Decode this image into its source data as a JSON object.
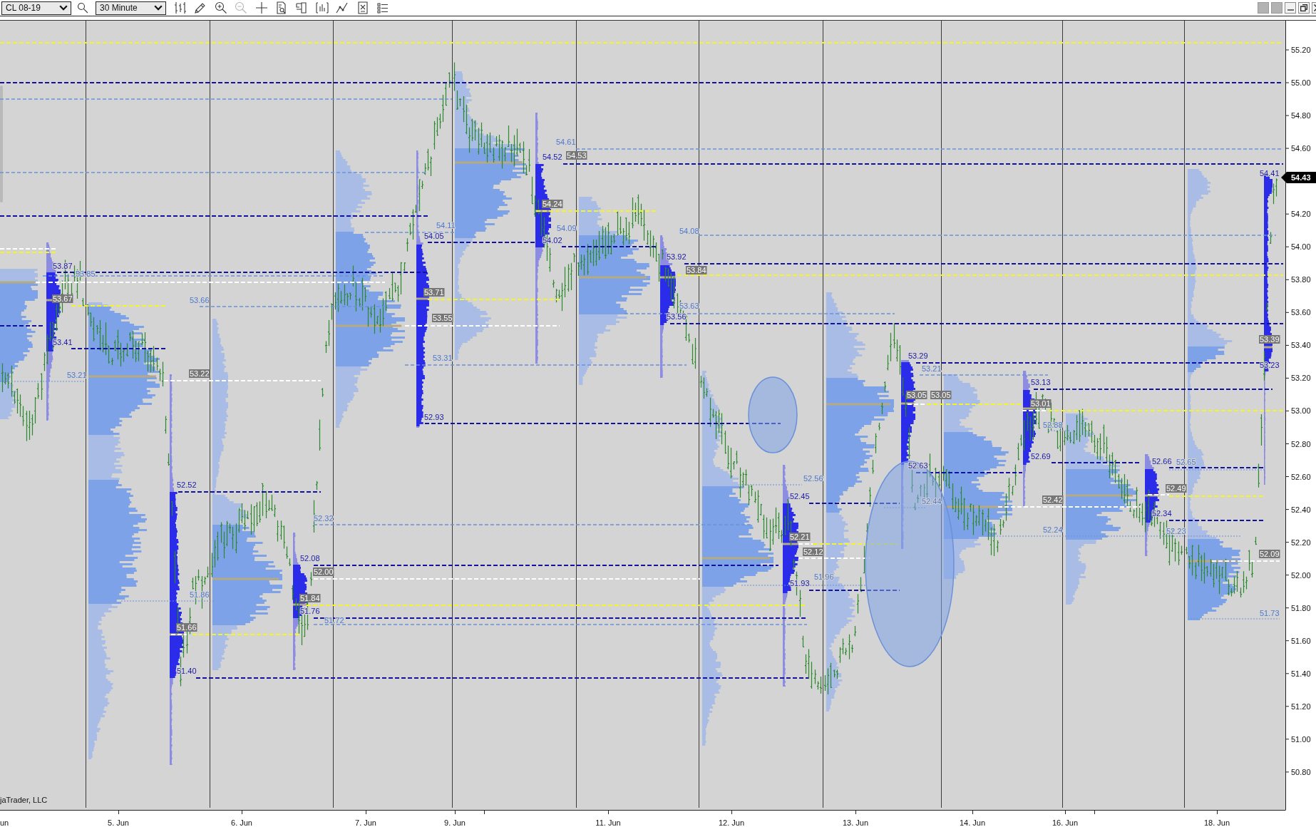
{
  "toolbar": {
    "instrument": {
      "value": "CL 08-19"
    },
    "interval": {
      "value": "30 Minute"
    },
    "tools": [
      {
        "kind": "bars",
        "disabled": false
      },
      {
        "kind": "pencil",
        "disabled": false
      },
      {
        "kind": "zoomin",
        "disabled": false
      },
      {
        "kind": "zoomout",
        "disabled": true
      },
      {
        "kind": "crosshair",
        "disabled": false
      },
      {
        "kind": "properties",
        "disabled": false
      },
      {
        "kind": "bracket",
        "disabled": false
      },
      {
        "kind": "barscale",
        "disabled": false
      },
      {
        "kind": "lines",
        "disabled": false
      },
      {
        "kind": "strategy",
        "disabled": false
      },
      {
        "kind": "list",
        "disabled": false
      }
    ]
  },
  "chart": {
    "levels": [
      {
        "label": "53.87",
        "kind": "extreme"
      },
      {
        "label": "53.85",
        "kind": "value"
      },
      {
        "label": "53.67",
        "kind": "poc"
      },
      {
        "label": "53.41",
        "kind": "extreme"
      },
      {
        "label": "53.21",
        "kind": "value"
      },
      {
        "label": "53.66",
        "kind": "value"
      },
      {
        "label": "53.22",
        "kind": "poc"
      },
      {
        "label": "52.52",
        "kind": "extreme"
      },
      {
        "label": "51.86",
        "kind": "value"
      },
      {
        "label": "51.66",
        "kind": "poc"
      },
      {
        "label": "51.40",
        "kind": "extreme"
      },
      {
        "label": "52.32",
        "kind": "value"
      },
      {
        "label": "52.08",
        "kind": "extreme"
      },
      {
        "label": "52.00",
        "kind": "poc"
      },
      {
        "label": "51.84",
        "kind": "poc"
      },
      {
        "label": "51.76",
        "kind": "extreme"
      },
      {
        "label": "51.72",
        "kind": "value"
      },
      {
        "label": "54.11",
        "kind": "value"
      },
      {
        "label": "54.05",
        "kind": "extreme"
      },
      {
        "label": "53.71",
        "kind": "poc"
      },
      {
        "label": "53.55",
        "kind": "poc"
      },
      {
        "label": "53.31",
        "kind": "value"
      },
      {
        "label": "52.93",
        "kind": "extreme"
      },
      {
        "label": "54.61",
        "kind": "value"
      },
      {
        "label": "54.52",
        "kind": "extreme"
      },
      {
        "label": "54.53",
        "kind": "poc"
      },
      {
        "label": "54.24",
        "kind": "poc"
      },
      {
        "label": "54.09",
        "kind": "value"
      },
      {
        "label": "54.02",
        "kind": "extreme"
      },
      {
        "label": "54.08",
        "kind": "value"
      },
      {
        "label": "53.92",
        "kind": "extreme"
      },
      {
        "label": "53.84",
        "kind": "poc"
      },
      {
        "label": "53.63",
        "kind": "value"
      },
      {
        "label": "53.56",
        "kind": "extreme"
      },
      {
        "label": "52.56",
        "kind": "value"
      },
      {
        "label": "52.45",
        "kind": "extreme"
      },
      {
        "label": "52.21",
        "kind": "poc"
      },
      {
        "label": "52.12",
        "kind": "poc"
      },
      {
        "label": "51.96",
        "kind": "value"
      },
      {
        "label": "51.93",
        "kind": "extreme"
      },
      {
        "label": "53.29",
        "kind": "extreme"
      },
      {
        "label": "53.21",
        "kind": "value"
      },
      {
        "label": "53.05",
        "kind": "poc"
      },
      {
        "label": "53.05",
        "kind": "poc"
      },
      {
        "label": "52.63",
        "kind": "extreme"
      },
      {
        "label": "52.44",
        "kind": "value"
      },
      {
        "label": "53.13",
        "kind": "extreme"
      },
      {
        "label": "53.01",
        "kind": "poc"
      },
      {
        "label": "52.88",
        "kind": "value"
      },
      {
        "label": "52.69",
        "kind": "extreme"
      },
      {
        "label": "52.42",
        "kind": "poc"
      },
      {
        "label": "52.24",
        "kind": "value"
      },
      {
        "label": "52.66",
        "kind": "extreme"
      },
      {
        "label": "52.65",
        "kind": "value"
      },
      {
        "label": "52.49",
        "kind": "poc"
      },
      {
        "label": "52.34",
        "kind": "extreme"
      },
      {
        "label": "52.23",
        "kind": "value"
      },
      {
        "label": "54.41",
        "kind": "extreme"
      },
      {
        "label": "53.39",
        "kind": "poc"
      },
      {
        "label": "53.23",
        "kind": "extreme"
      },
      {
        "label": "52.09",
        "kind": "poc"
      },
      {
        "label": "51.73",
        "kind": "value"
      }
    ],
    "copyright": "jaTrader, LLC",
    "price_axis": {
      "ticks": [
        "55.20",
        "55.00",
        "54.80",
        "54.60",
        "54.20",
        "54.00",
        "53.80",
        "53.60",
        "53.40",
        "53.20",
        "53.00",
        "52.80",
        "52.60",
        "52.40",
        "52.20",
        "52.00",
        "51.80",
        "51.60",
        "51.40",
        "51.20",
        "51.00",
        "50.80"
      ],
      "current_price": "54.43"
    },
    "date_axis": {
      "labels": [
        "un",
        "5. Jun",
        "6. Jun",
        "7. Jun",
        "9. Jun",
        "11. Jun",
        "12. Jun",
        "13. Jun",
        "14. Jun",
        "16. Jun",
        "18. Jun"
      ]
    }
  }
}
